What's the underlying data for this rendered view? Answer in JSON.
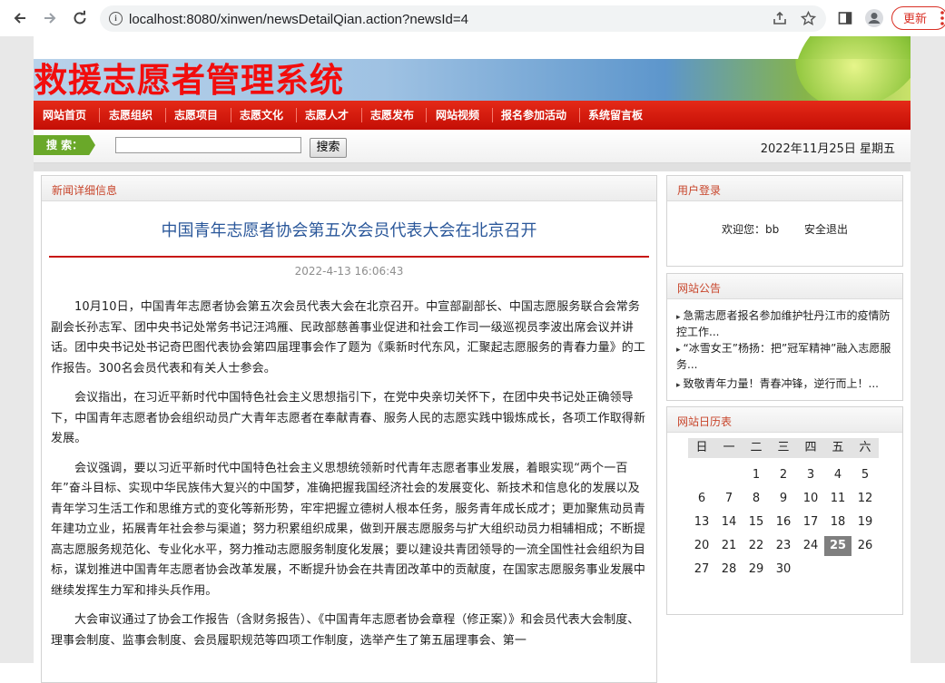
{
  "browser": {
    "url": "localhost:8080/xinwen/newsDetailQian.action?newsId=4",
    "update_label": "更新"
  },
  "site": {
    "title": "救援志愿者管理系统"
  },
  "menu": [
    "网站首页",
    "志愿组织",
    "志愿项目",
    "志愿文化",
    "志愿人才",
    "志愿发布",
    "网站视频",
    "报名参加活动",
    "系统留言板"
  ],
  "search": {
    "tag": "搜 索：",
    "button": "搜索",
    "value": "",
    "date": "2022年11月25日 星期五"
  },
  "news_panel": {
    "heading": "新闻详细信息",
    "title": "中国青年志愿者协会第五次会员代表大会在北京召开",
    "time": "2022-4-13 16:06:43",
    "paragraphs": [
      "10月10日，中国青年志愿者协会第五次会员代表大会在北京召开。中宣部副部长、中国志愿服务联合会常务副会长孙志军、团中央书记处常务书记汪鸿雁、民政部慈善事业促进和社会工作司一级巡视员李波出席会议并讲话。团中央书记处书记奇巴图代表协会第四届理事会作了题为《乘新时代东风，汇聚起志愿服务的青春力量》的工作报告。300名会员代表和有关人士参会。",
      "会议指出，在习近平新时代中国特色社会主义思想指引下，在党中央亲切关怀下，在团中央书记处正确领导下，中国青年志愿者协会组织动员广大青年志愿者在奉献青春、服务人民的志愿实践中锻炼成长，各项工作取得新发展。",
      "会议强调，要以习近平新时代中国特色社会主义思想统领新时代青年志愿者事业发展，着眼实现“两个一百年”奋斗目标、实现中华民族伟大复兴的中国梦，准确把握我国经济社会的发展变化、新技术和信息化的发展以及青年学习生活工作和思维方式的变化等新形势，牢牢把握立德树人根本任务，服务青年成长成才；更加聚焦动员青年建功立业，拓展青年社会参与渠道；努力积累组织成果，做到开展志愿服务与扩大组织动员力相辅相成；不断提高志愿服务规范化、专业化水平，努力推动志愿服务制度化发展；要以建设共青团领导的一流全国性社会组织为目标，谋划推进中国青年志愿者协会改革发展，不断提升协会在共青团改革中的贡献度，在国家志愿服务事业发展中继续发挥生力军和排头兵作用。",
      "大会审议通过了协会工作报告（含财务报告）、《中国青年志愿者协会章程（修正案）》和会员代表大会制度、理事会制度、监事会制度、会员履职规范等四项工作制度，选举产生了第五届理事会、第一"
    ]
  },
  "login_panel": {
    "heading": "用户登录",
    "welcome": "欢迎您：bb",
    "logout": "安全退出"
  },
  "notice_panel": {
    "heading": "网站公告",
    "items": [
      "急需志愿者报名参加维护牡丹江市的疫情防控工作...",
      "“冰雪女王”杨扬：把”冠军精神”融入志愿服务...",
      "致敬青年力量！青春冲锋，逆行而上！..."
    ]
  },
  "calendar_panel": {
    "heading": "网站日历表",
    "weekdays": [
      "日",
      "一",
      "二",
      "三",
      "四",
      "五",
      "六"
    ],
    "weeks": [
      [
        "",
        "",
        "1",
        "2",
        "3",
        "4",
        "5"
      ],
      [
        "6",
        "7",
        "8",
        "9",
        "10",
        "11",
        "12"
      ],
      [
        "13",
        "14",
        "15",
        "16",
        "17",
        "18",
        "19"
      ],
      [
        "20",
        "21",
        "22",
        "23",
        "24",
        "25",
        "26"
      ],
      [
        "27",
        "28",
        "29",
        "30",
        "",
        "",
        ""
      ]
    ],
    "today": "25"
  }
}
